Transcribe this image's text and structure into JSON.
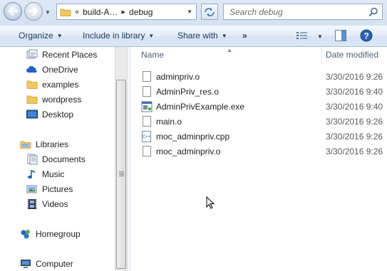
{
  "address": {
    "crumbs": [
      "«",
      "build-A…",
      "debug"
    ]
  },
  "search": {
    "placeholder": "Search debug"
  },
  "toolbar": {
    "organize": "Organize",
    "include_in_library": "Include in library",
    "share_with": "Share with",
    "more": "»"
  },
  "nav": {
    "recent_places": "Recent Places",
    "onedrive": "OneDrive",
    "examples": "examples",
    "wordpress": "wordpress",
    "desktop": "Desktop",
    "libraries": "Libraries",
    "documents": "Documents",
    "music": "Music",
    "pictures": "Pictures",
    "videos": "Videos",
    "homegroup": "Homegroup",
    "computer": "Computer"
  },
  "columns": {
    "name": "Name",
    "date_modified": "Date modified"
  },
  "files": [
    {
      "name": "adminpriv.o",
      "date": "3/30/2016 9:26",
      "icon": "generic-file-icon"
    },
    {
      "name": "AdminPriv_res.o",
      "date": "3/30/2016 9:40",
      "icon": "generic-file-icon"
    },
    {
      "name": "AdminPrivExample.exe",
      "date": "3/30/2016 9:40",
      "icon": "exe-file-icon"
    },
    {
      "name": "main.o",
      "date": "3/30/2016 9:26",
      "icon": "generic-file-icon"
    },
    {
      "name": "moc_adminpriv.cpp",
      "date": "3/30/2016 9:26",
      "icon": "cpp-file-icon"
    },
    {
      "name": "moc_adminpriv.o",
      "date": "3/30/2016 9:26",
      "icon": "generic-file-icon"
    }
  ],
  "colors": {
    "accent": "#1e395b",
    "folder": "#f2c75c"
  }
}
